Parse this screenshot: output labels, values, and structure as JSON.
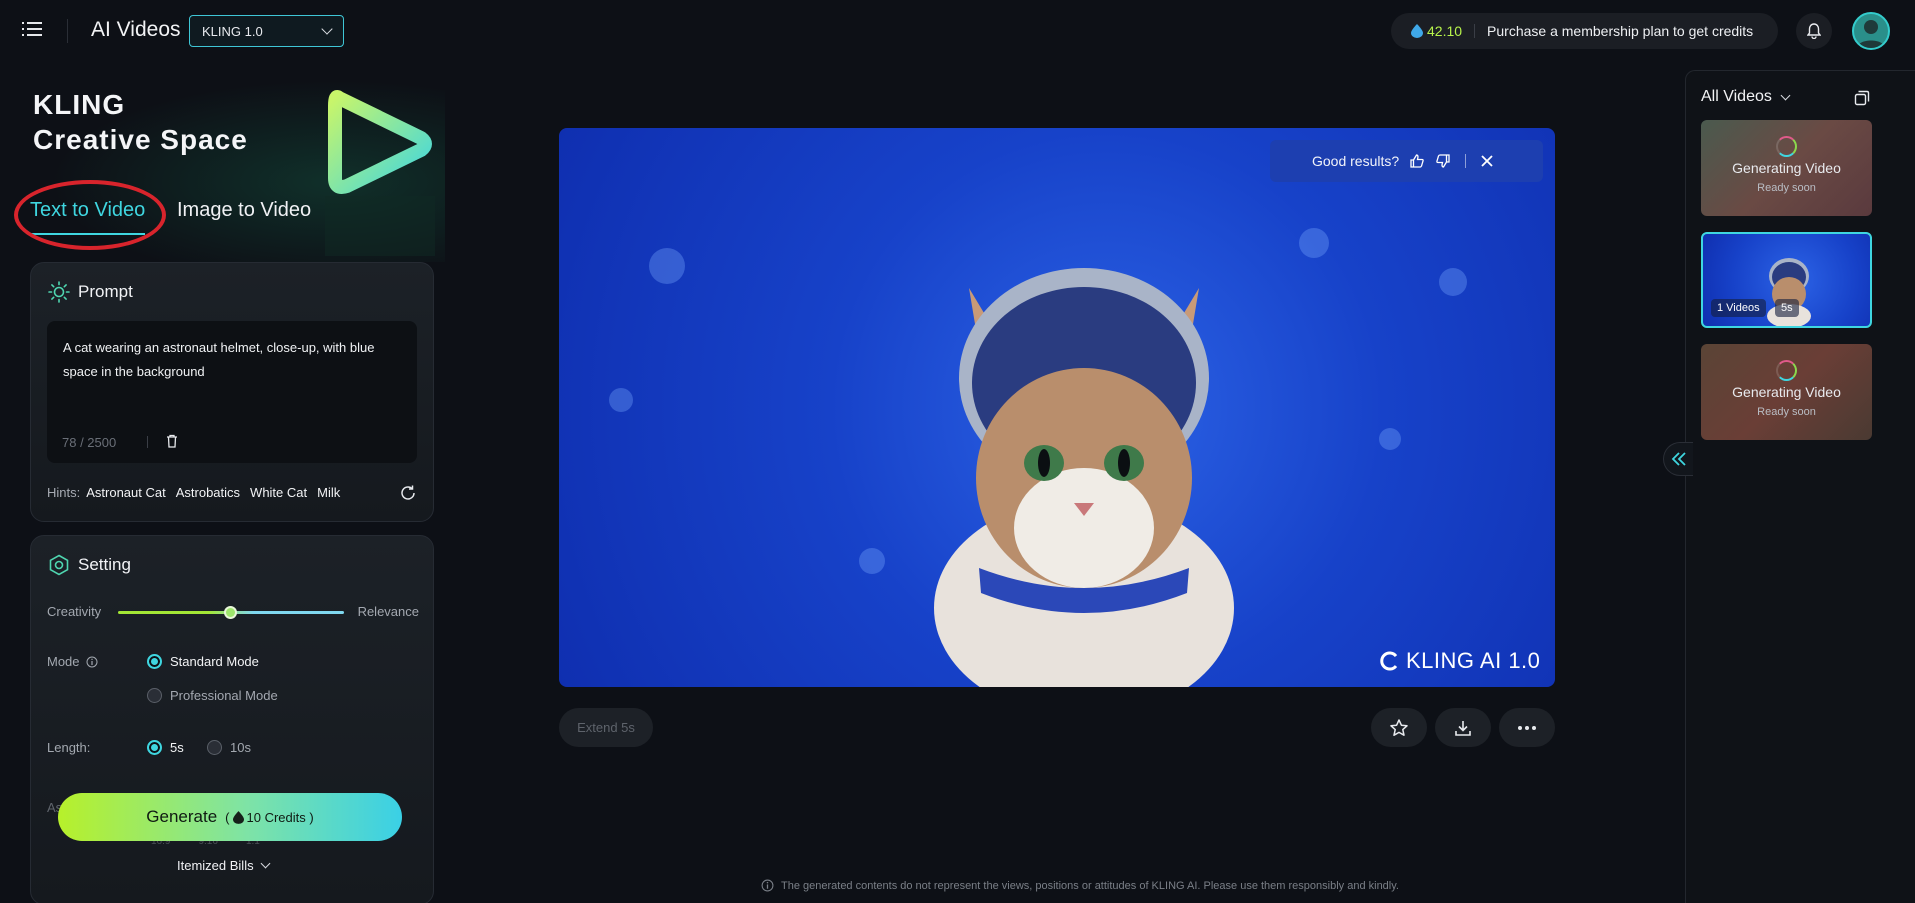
{
  "header": {
    "title": "AI Videos",
    "model": "KLING 1.0",
    "credits_amount": "42.10",
    "credits_message": "Purchase a membership plan to get credits"
  },
  "hero": {
    "line1": "KLING",
    "line2": "Creative Space"
  },
  "tabs": [
    {
      "label": "Text to Video",
      "active": true
    },
    {
      "label": "Image to Video",
      "active": false
    }
  ],
  "prompt": {
    "title": "Prompt",
    "text": "A cat wearing an astronaut helmet, close-up, with blue space in the background",
    "counter": "78 / 2500",
    "hints_label": "Hints:",
    "hints": [
      "Astronaut Cat",
      "Astrobatics",
      "White Cat",
      "Milk"
    ]
  },
  "setting": {
    "title": "Setting",
    "slider_left": "Creativity",
    "slider_right": "Relevance",
    "slider_value": 0.5,
    "mode_label": "Mode",
    "modes": [
      "Standard Mode",
      "Professional Mode"
    ],
    "selected_mode": "Standard Mode",
    "length_label": "Length:",
    "lengths": [
      "5s",
      "10s"
    ],
    "selected_length": "5s",
    "aspect_label": "As",
    "aspect_ratios": [
      "16:9",
      "9:16",
      "1:1"
    ]
  },
  "generate": {
    "label": "Generate",
    "credits_open": "(",
    "credits": "10 Credits )"
  },
  "itemized": "Itemized Bills",
  "video": {
    "feedback_question": "Good results?",
    "watermark": "KLING AI 1.0"
  },
  "actions": {
    "extend": "Extend 5s"
  },
  "disclaimer": "The generated contents do not represent the views, positions or attitudes of KLING AI. Please use them responsibly and kindly.",
  "right": {
    "title": "All Videos",
    "items": [
      {
        "status": "Generating Video",
        "sub": "Ready soon"
      },
      {
        "count": "1 Videos",
        "duration": "5s"
      },
      {
        "status": "Generating Video",
        "sub": "Ready soon"
      }
    ]
  },
  "colors": {
    "accent": "#3fd6e0",
    "lime": "#b6f24b",
    "background": "#0d1016",
    "annotation": "#d8242c"
  }
}
